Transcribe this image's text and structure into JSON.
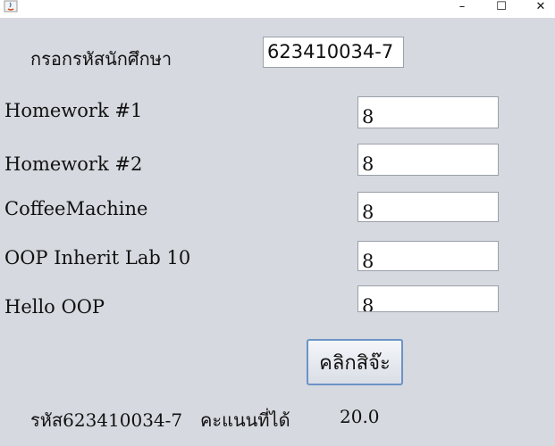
{
  "window": {
    "min_glyph": "–",
    "max_glyph": "☐",
    "close_glyph": "✕"
  },
  "form": {
    "id_label": "กรอกรหัสนักศึกษา",
    "id_value": "623410034-7",
    "rows": [
      {
        "label": "Homework #1",
        "value": "8"
      },
      {
        "label": "Homework #2",
        "value": "8"
      },
      {
        "label": "CoffeeMachine",
        "value": "8"
      },
      {
        "label": "OOP Inherit Lab 10",
        "value": "8"
      },
      {
        "label": "Hello OOP",
        "value": "8"
      }
    ],
    "submit_label": "คลิกสิจ๊ะ"
  },
  "result": {
    "id_text": "รหัส623410034-7",
    "score_label": "คะแนนที่ได้",
    "score_value": "20.0"
  }
}
